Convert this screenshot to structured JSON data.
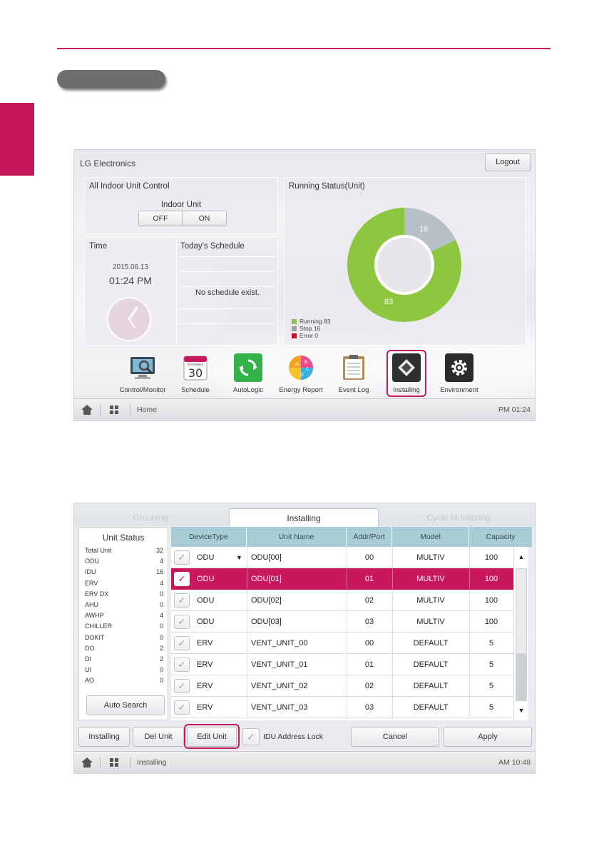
{
  "home": {
    "brand": "LG Electronics",
    "logout_label": "Logout",
    "indoor_panel": {
      "title": "All Indoor Unit Control",
      "unit_label": "Indoor Unit",
      "off_label": "OFF",
      "on_label": "ON"
    },
    "time_panel": {
      "title": "Time",
      "date": "2015.06.13",
      "time": "01:24 PM"
    },
    "schedule_panel": {
      "title": "Today's Schedule",
      "empty_text": "No schedule exist."
    },
    "running_panel": {
      "title": "Running Status(Unit)",
      "running_value": "83",
      "stop_value": "16",
      "legend": {
        "running": "Running 83",
        "stop": "Stop 16",
        "error": "Error 0"
      },
      "colors": {
        "running": "#8dc63f",
        "stop": "#b7c0c6",
        "error": "#e2001a"
      }
    },
    "apps": [
      {
        "label": "Control/Monitor",
        "icon": "monitor-icon"
      },
      {
        "label": "Schedule",
        "icon": "calendar-icon",
        "calendar_month": "NOVEMBER",
        "calendar_day": "30"
      },
      {
        "label": "AutoLogic",
        "icon": "refresh-icon"
      },
      {
        "label": "Energy Report",
        "icon": "pie-chart-icon",
        "letters": [
          "A",
          "B",
          "C",
          "D"
        ]
      },
      {
        "label": "Event Log",
        "icon": "clipboard-icon"
      },
      {
        "label": "Installing",
        "icon": "ceiling-cassette-icon",
        "selected": true
      },
      {
        "label": "Environment",
        "icon": "gear-icon"
      }
    ],
    "taskbar": {
      "label": "Home",
      "time": "PM 01:24"
    }
  },
  "installing": {
    "tabs": [
      {
        "label": "Grouping",
        "active": false
      },
      {
        "label": "Installing",
        "active": true
      },
      {
        "label": "Cycle Monitoring",
        "active": false
      }
    ],
    "unit_status": {
      "title": "Unit Status",
      "rows": [
        {
          "label": "Total Unit",
          "value": "32"
        },
        {
          "label": "ODU",
          "value": "4"
        },
        {
          "label": "IDU",
          "value": "16"
        },
        {
          "label": "ERV",
          "value": "4"
        },
        {
          "label": "ERV DX",
          "value": "0"
        },
        {
          "label": "AHU",
          "value": "0"
        },
        {
          "label": "AWHP",
          "value": "4"
        },
        {
          "label": "CHILLER",
          "value": "0"
        },
        {
          "label": "DOKIT",
          "value": "0"
        },
        {
          "label": "DO",
          "value": "2"
        },
        {
          "label": "DI",
          "value": "2"
        },
        {
          "label": "UI",
          "value": "0"
        },
        {
          "label": "AO",
          "value": "0"
        }
      ],
      "auto_search_label": "Auto Search"
    },
    "table": {
      "columns": [
        "DeviceType",
        "Unit Name",
        "Addr/Port",
        "Model",
        "Capacity"
      ],
      "rows": [
        {
          "type": "ODU",
          "name": "ODU[00]",
          "addr": "00",
          "model": "MULTIV",
          "capacity": "100",
          "selected": false
        },
        {
          "type": "ODU",
          "name": "ODU[01]",
          "addr": "01",
          "model": "MULTIV",
          "capacity": "100",
          "selected": true
        },
        {
          "type": "ODU",
          "name": "ODU[02]",
          "addr": "02",
          "model": "MULTIV",
          "capacity": "100",
          "selected": false
        },
        {
          "type": "ODU",
          "name": "ODU[03]",
          "addr": "03",
          "model": "MULTIV",
          "capacity": "100",
          "selected": false
        },
        {
          "type": "ERV",
          "name": "VENT_UNIT_00",
          "addr": "00",
          "model": "DEFAULT",
          "capacity": "5",
          "selected": false
        },
        {
          "type": "ERV",
          "name": "VENT_UNIT_01",
          "addr": "01",
          "model": "DEFAULT",
          "capacity": "5",
          "selected": false
        },
        {
          "type": "ERV",
          "name": "VENT_UNIT_02",
          "addr": "02",
          "model": "DEFAULT",
          "capacity": "5",
          "selected": false
        },
        {
          "type": "ERV",
          "name": "VENT_UNIT_03",
          "addr": "03",
          "model": "DEFAULT",
          "capacity": "5",
          "selected": false
        }
      ]
    },
    "buttons": {
      "installing": "Installing",
      "del_unit": "Del Unit",
      "edit_unit": "Edit Unit",
      "idu_lock": "IDU Address Lock",
      "cancel": "Cancel",
      "apply": "Apply"
    },
    "taskbar": {
      "label": "Installing",
      "time": "AM 10:48"
    }
  },
  "colors": {
    "accent": "#c8175d",
    "header": "#a8cdd6"
  }
}
